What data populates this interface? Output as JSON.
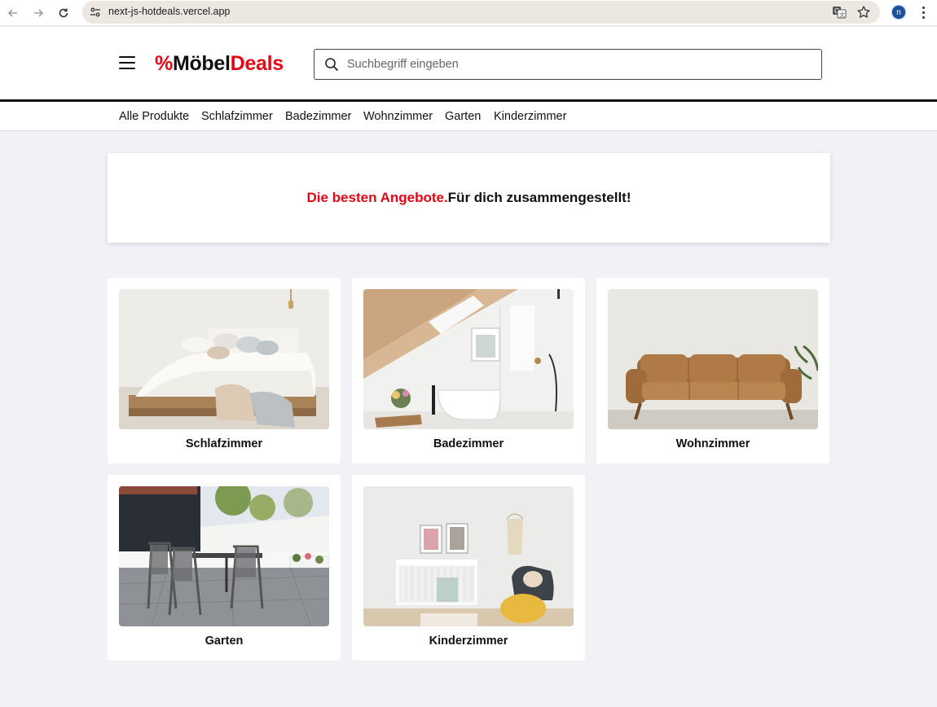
{
  "browser": {
    "url": "next-js-hotdeals.vercel.app",
    "profile_initial": "n"
  },
  "header": {
    "logo": {
      "pct": "%",
      "moebel": "Möbel",
      "deals": "Deals"
    },
    "search_placeholder": "Suchbegriff eingeben"
  },
  "nav": {
    "items": [
      "Alle Produkte",
      "Schlafzimmer",
      "Badezimmer",
      "Wohnzimmer",
      "Garten",
      "Kinderzimmer"
    ]
  },
  "hero": {
    "highlight": "Die besten Angebote.",
    "text": "Für dich zusammengestellt!"
  },
  "categories": [
    {
      "title": "Schlafzimmer"
    },
    {
      "title": "Badezimmer"
    },
    {
      "title": "Wohnzimmer"
    },
    {
      "title": "Garten"
    },
    {
      "title": "Kinderzimmer"
    }
  ],
  "colors": {
    "accent": "#e30613",
    "page_bg": "#f1f2f6"
  }
}
